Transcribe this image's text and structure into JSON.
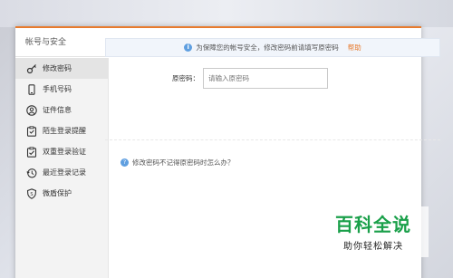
{
  "dialog": {
    "title": "帐号与安全"
  },
  "sidebar": {
    "items": [
      {
        "label": "修改密码",
        "icon": "key-icon",
        "active": true
      },
      {
        "label": "手机号码",
        "icon": "phone-icon",
        "active": false
      },
      {
        "label": "证件信息",
        "icon": "user-id-icon",
        "active": false
      },
      {
        "label": "陌生登录提醒",
        "icon": "clipboard-alert-icon",
        "active": false
      },
      {
        "label": "双重登录验证",
        "icon": "clipboard-check-icon",
        "active": false
      },
      {
        "label": "最近登录记录",
        "icon": "history-icon",
        "active": false
      },
      {
        "label": "微盾保护",
        "icon": "shield-icon",
        "active": false
      }
    ]
  },
  "main": {
    "notice_text": "为保障您的帐号安全，修改密码前请填写原密码",
    "help_link": "帮助",
    "password_label": "原密码：",
    "password_placeholder": "请输入原密码",
    "forgot_text": "修改密码不记得原密码时怎么办？"
  },
  "watermark": {
    "main": "百科全说",
    "sub": "助你轻松解决"
  },
  "colors": {
    "accent": "#e77a2d",
    "info": "#5f9fe0",
    "watermark_green": "#1aa04a"
  }
}
